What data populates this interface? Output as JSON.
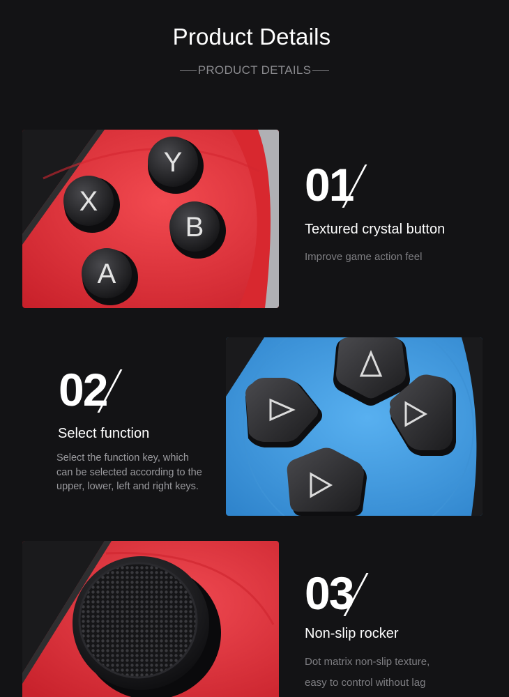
{
  "header": {
    "title": "Product Details",
    "subtitle": "PRODUCT DETAILS"
  },
  "features": [
    {
      "number": "01",
      "title": "Textured crystal button",
      "description": "Improve game action feel",
      "button_letters": [
        "Y",
        "X",
        "B",
        "A"
      ],
      "panel_color": "#e8323c"
    },
    {
      "number": "02",
      "title": "Select function",
      "description_lines": [
        "Select the function key, which",
        "can be selected according to the",
        "upper, lower, left and right keys."
      ],
      "panel_color": "#3f9be0"
    },
    {
      "number": "03",
      "title": "Non-slip rocker",
      "description_lines": [
        "Dot matrix non-slip texture,",
        "easy to control without lag"
      ],
      "panel_color": "#e8323c"
    }
  ]
}
